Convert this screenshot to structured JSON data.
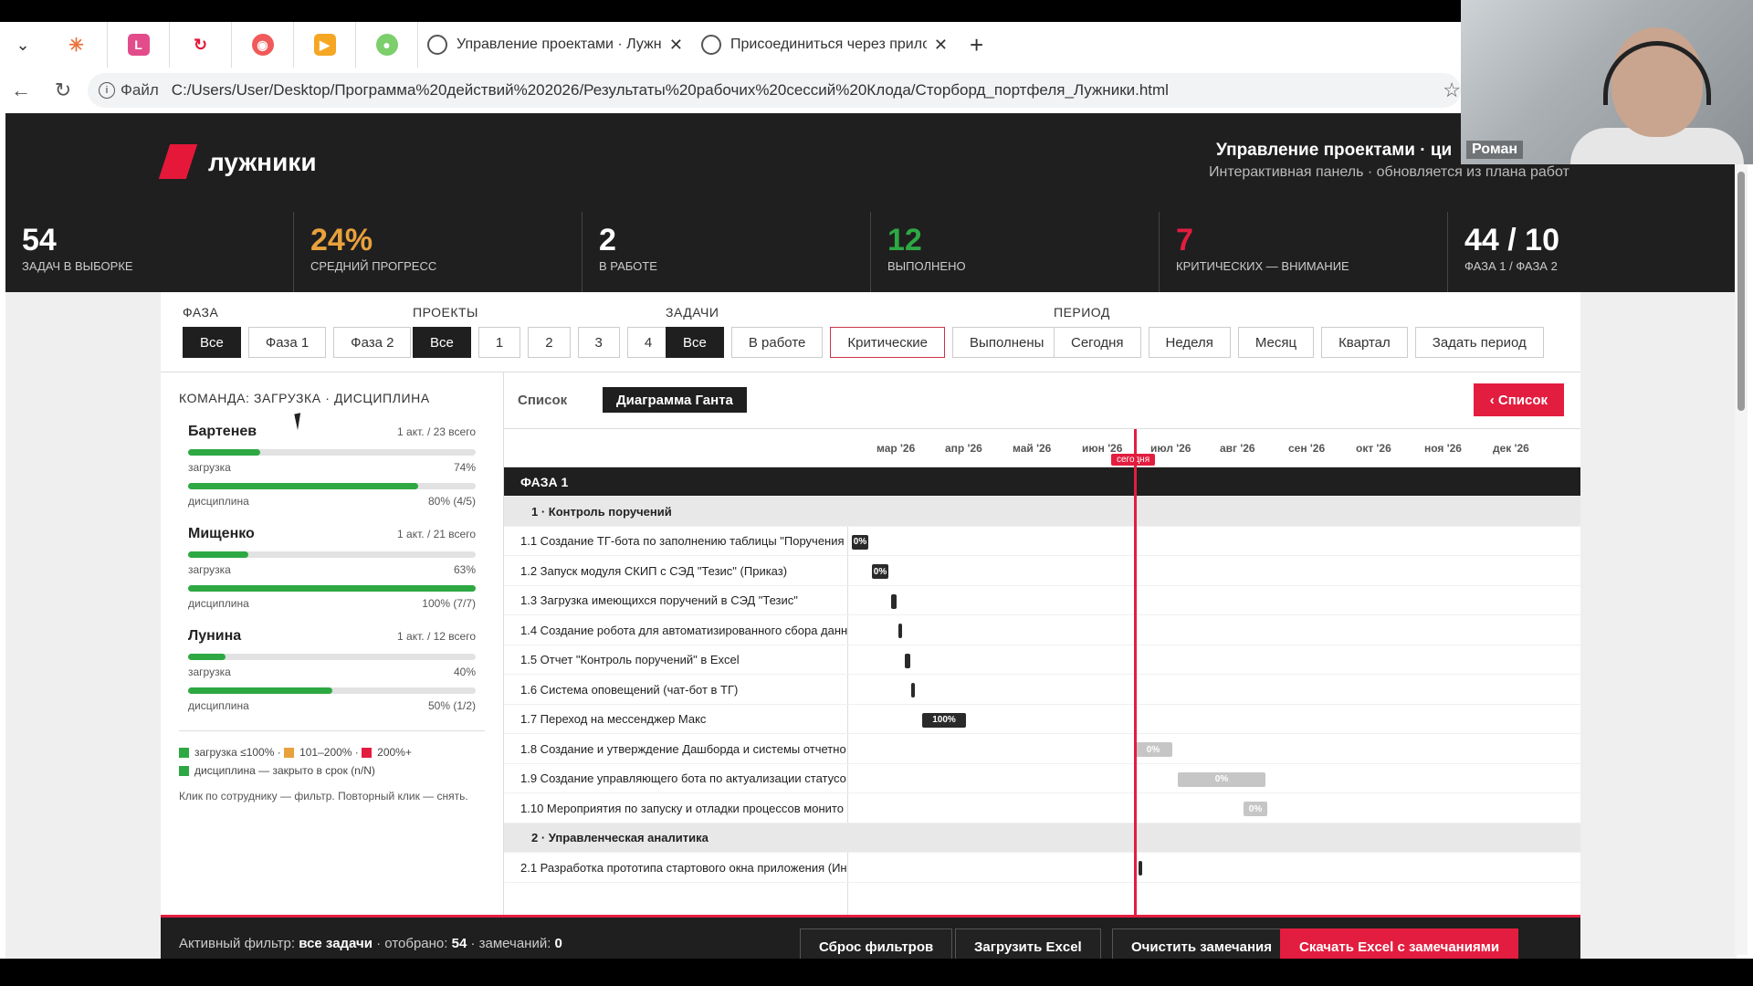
{
  "browser": {
    "tabs": [
      {
        "label": "Управление проектами · Лужник"
      },
      {
        "label": "Присоединиться через приложе"
      }
    ],
    "address": {
      "scheme": "Файл",
      "url": "C:/Users/User/Desktop/Программа%20действий%202026/Результаты%20рабочих%20сессий%20Клода/Сторборд_портфеля_Лужники.html"
    }
  },
  "webcam": {
    "name": "Роман"
  },
  "header": {
    "logo": "лужники",
    "title": "Управление проектами · ци",
    "subtitle": "Интерактивная панель · обновляется из плана работ"
  },
  "kpis": [
    {
      "value": "54",
      "label": "ЗАДАЧ В ВЫБОРКЕ",
      "color": "#ffffff"
    },
    {
      "value": "24%",
      "label": "СРЕДНИЙ ПРОГРЕСС",
      "color": "#e8a13c"
    },
    {
      "value": "2",
      "label": "В РАБОТЕ",
      "color": "#ffffff"
    },
    {
      "value": "12",
      "label": "ВЫПОЛНЕНО",
      "color": "#2ea843"
    },
    {
      "value": "7",
      "label": "КРИТИЧЕСКИХ — ВНИМАНИЕ",
      "color": "#e31d3f"
    },
    {
      "value": "44 / 10",
      "label": "ФАЗА 1 / ФАЗА 2",
      "color": "#ffffff"
    }
  ],
  "filters": {
    "phase": {
      "title": "ФАЗА",
      "options": [
        "Все",
        "Фаза 1",
        "Фаза 2"
      ]
    },
    "projects": {
      "title": "ПРОЕКТЫ",
      "options": [
        "Все",
        "1",
        "2",
        "3",
        "4"
      ]
    },
    "tasks": {
      "title": "ЗАДАЧИ",
      "options": [
        "Все",
        "В работе",
        "Критические",
        "Выполнены"
      ]
    },
    "period": {
      "title": "ПЕРИОД",
      "options": [
        "Сегодня",
        "Неделя",
        "Месяц",
        "Квартал",
        "Задать период"
      ]
    }
  },
  "team": {
    "title": "КОМАНДА: ЗАГРУЗКА · ДИСЦИПЛИНА",
    "load_label": "загрузка",
    "discipline_label": "дисциплина",
    "people": [
      {
        "name": "Бартенев",
        "count": "1 акт. / 23 всего",
        "load": 0.25,
        "load_text": "74%",
        "discipline": 0.8,
        "discipline_text": "80% (4/5)"
      },
      {
        "name": "Мищенко",
        "count": "1 акт. / 21 всего",
        "load": 0.21,
        "load_text": "63%",
        "discipline": 1.0,
        "discipline_text": "100% (7/7)"
      },
      {
        "name": "Лунина",
        "count": "1 акт. / 12 всего",
        "load": 0.13,
        "load_text": "40%",
        "discipline": 0.5,
        "discipline_text": "50% (1/2)"
      }
    ],
    "legend": {
      "l1": "загрузка ≤100%",
      "l2": "101–200%",
      "l3": "200%+",
      "l4": "дисциплина — закрыто в срок (n/N)"
    },
    "hint": "Клик по сотруднику — фильтр. Повторный клик — снять.",
    "colors": {
      "green": "#2ea843",
      "orange": "#e8a13c",
      "red": "#e31d3f"
    }
  },
  "gantt": {
    "view_tabs": {
      "list": "Список",
      "gantt": "Диаграмма Ганта"
    },
    "back_button": "‹ Список",
    "months": [
      "мар '26",
      "апр '26",
      "май '26",
      "июн '26",
      "июл '26",
      "авг '26",
      "сен '26",
      "окт '26",
      "ноя '26",
      "дек '26"
    ],
    "today_label": "сегодня",
    "phase_label": "ФАЗА 1",
    "rows": [
      {
        "kind": "group",
        "label": "1 · Контроль поручений"
      },
      {
        "kind": "task",
        "label": "1.1 Создание ТГ-бота по заполнению таблицы \"Поручения",
        "bar": "0%"
      },
      {
        "kind": "task",
        "label": "1.2 Запуск модуля СКИП с СЭД \"Тезис\" (Приказ)",
        "bar": "0%"
      },
      {
        "kind": "task",
        "label": "1.3 Загрузка имеющихся поручений в СЭД \"Тезис\"",
        "bar": ""
      },
      {
        "kind": "task",
        "label": "1.4 Создание робота для автоматизированного сбора данн",
        "bar": ""
      },
      {
        "kind": "task",
        "label": "1.5 Отчет \"Контроль поручений\" в Excel",
        "bar": ""
      },
      {
        "kind": "task",
        "label": "1.6 Система оповещений (чат-бот в ТГ)",
        "bar": ""
      },
      {
        "kind": "task",
        "label": "1.7 Переход на мессенджер Макс",
        "bar": "100%"
      },
      {
        "kind": "task",
        "label": "1.8 Создание и утверждение Дашборда и системы отчетно",
        "bar": "0%"
      },
      {
        "kind": "task",
        "label": "1.9 Создание управляющего бота по актуализации статусо",
        "bar": "0%"
      },
      {
        "kind": "task",
        "label": "1.10 Мероприятия по запуску и отладки процессов монито",
        "bar": "0%"
      },
      {
        "kind": "group",
        "label": "2 · Управленческая аналитика"
      },
      {
        "kind": "task",
        "label": "2.1 Разработка прототипа стартового окна приложения (Ин",
        "bar": ""
      }
    ]
  },
  "footer": {
    "active_filter_label": "Активный фильтр:",
    "active_filter_value": "все задачи",
    "selected_label": "· отобрано:",
    "selected_value": "54",
    "remarks_label": "· замечаний:",
    "remarks_value": "0",
    "reset": "Сброс фильтров",
    "load_excel": "Загрузить Excel",
    "clear_remarks": "Очистить замечания",
    "download": "Скачать Excel с замечаниями"
  }
}
